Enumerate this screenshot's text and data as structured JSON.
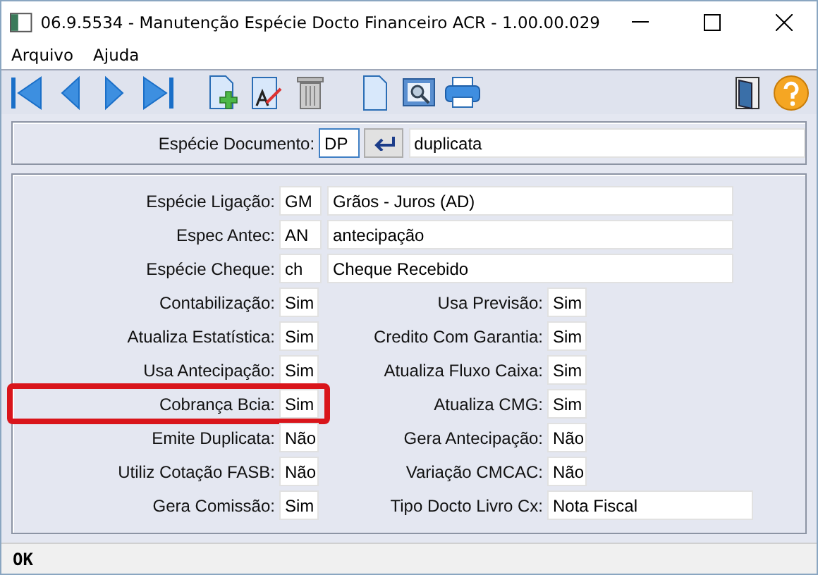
{
  "window": {
    "title": "06.9.5534 - Manutenção Espécie Docto Financeiro ACR - 1.00.00.029"
  },
  "menu": [
    "Arquivo",
    "Ajuda"
  ],
  "toolbar": [
    {
      "kind": "first"
    },
    {
      "kind": "prev"
    },
    {
      "kind": "next"
    },
    {
      "kind": "last"
    },
    {
      "kind": "sep"
    },
    {
      "kind": "add"
    },
    {
      "kind": "edit"
    },
    {
      "kind": "delete"
    },
    {
      "kind": "sep"
    },
    {
      "kind": "document"
    },
    {
      "kind": "preview"
    },
    {
      "kind": "print"
    },
    {
      "kind": "spacer"
    },
    {
      "kind": "exit"
    },
    {
      "kind": "help"
    }
  ],
  "header": {
    "label": "Espécie Documento:",
    "code": "DP",
    "description": "duplicata"
  },
  "linked": [
    {
      "label": "Espécie Ligação:",
      "code": "GM",
      "description": "Grãos - Juros (AD)"
    },
    {
      "label": "Espec Antec:",
      "code": "AN",
      "description": "antecipação"
    },
    {
      "label": "Espécie Cheque:",
      "code": "ch",
      "description": "Cheque Recebido"
    }
  ],
  "pairs": [
    {
      "left": {
        "label": "Contabilização:",
        "value": "Sim",
        "highlighted": false
      },
      "right": {
        "label": "Usa Previsão:",
        "value": "Sim",
        "wide": false
      }
    },
    {
      "left": {
        "label": "Atualiza Estatística:",
        "value": "Sim",
        "highlighted": false
      },
      "right": {
        "label": "Credito Com Garantia:",
        "value": "Sim",
        "wide": false
      }
    },
    {
      "left": {
        "label": "Usa Antecipação:",
        "value": "Sim",
        "highlighted": false
      },
      "right": {
        "label": "Atualiza Fluxo Caixa:",
        "value": "Sim",
        "wide": false
      }
    },
    {
      "left": {
        "label": "Cobrança Bcia:",
        "value": "Sim",
        "highlighted": true
      },
      "right": {
        "label": "Atualiza CMG:",
        "value": "Sim",
        "wide": false
      }
    },
    {
      "left": {
        "label": "Emite Duplicata:",
        "value": "Não",
        "highlighted": false
      },
      "right": {
        "label": "Gera Antecipação:",
        "value": "Não",
        "wide": false
      }
    },
    {
      "left": {
        "label": "Utiliz Cotação FASB:",
        "value": "Não",
        "highlighted": false
      },
      "right": {
        "label": "Variação CMCAC:",
        "value": "Não",
        "wide": false
      }
    },
    {
      "left": {
        "label": "Gera Comissão:",
        "value": "Sim",
        "highlighted": false
      },
      "right": {
        "label": "Tipo Docto Livro Cx:",
        "value": "Nota Fiscal",
        "wide": true
      }
    }
  ],
  "status_bar": {
    "text": "OK"
  }
}
